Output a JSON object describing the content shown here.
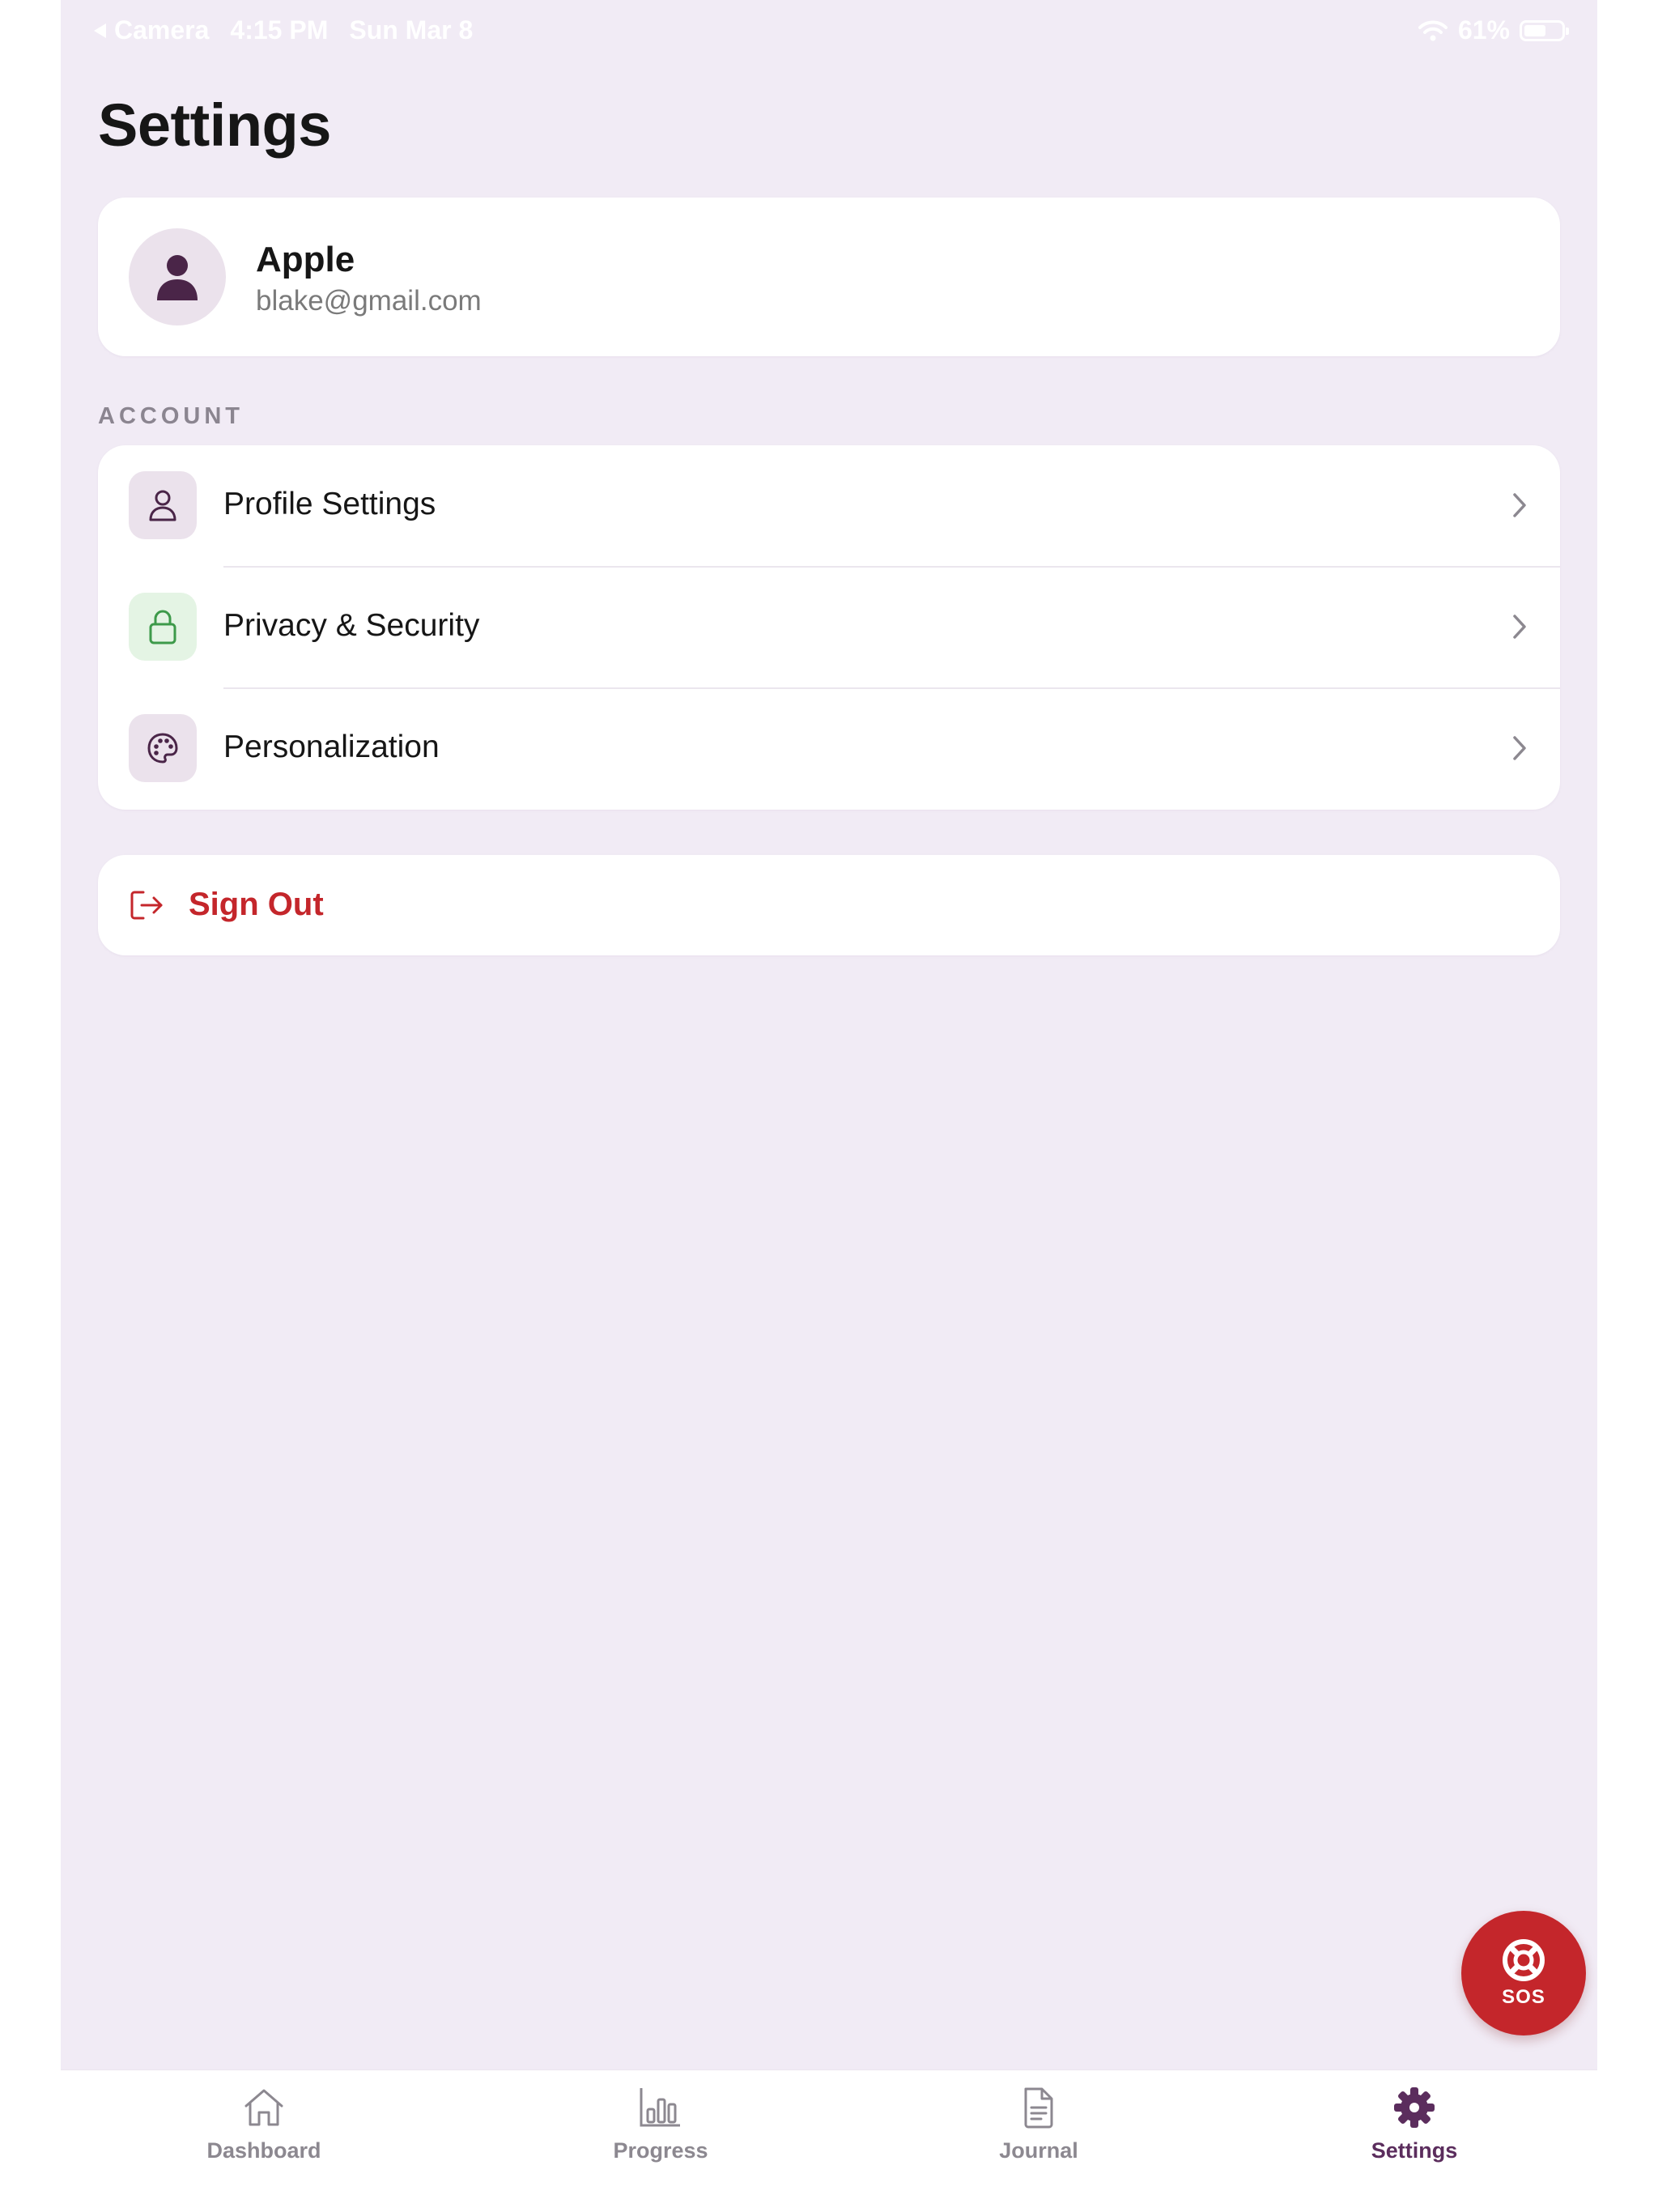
{
  "status_bar": {
    "back_app": "Camera",
    "time": "4:15 PM",
    "date": "Sun Mar 8",
    "battery": "61%"
  },
  "page": {
    "title": "Settings"
  },
  "profile": {
    "name": "Apple",
    "email": "blake@gmail.com",
    "avatar_icon": "person-icon"
  },
  "account": {
    "section_label": "ACCOUNT",
    "items": [
      {
        "label": "Profile Settings",
        "icon": "person-outline-icon"
      },
      {
        "label": "Privacy & Security",
        "icon": "lock-icon"
      },
      {
        "label": "Personalization",
        "icon": "palette-icon"
      }
    ]
  },
  "sign_out": {
    "label": "Sign Out",
    "icon": "sign-out-icon"
  },
  "sos": {
    "label": "SOS",
    "icon": "lifebuoy-icon"
  },
  "tabs": [
    {
      "label": "Dashboard",
      "icon": "home-icon",
      "active": false
    },
    {
      "label": "Progress",
      "icon": "bar-chart-icon",
      "active": false
    },
    {
      "label": "Journal",
      "icon": "document-icon",
      "active": false
    },
    {
      "label": "Settings",
      "icon": "gear-icon",
      "active": true
    }
  ],
  "colors": {
    "background": "#f1ebf5",
    "accent": "#5b2d5d",
    "danger": "#c4262b",
    "security_green": "#3d9a4a"
  }
}
